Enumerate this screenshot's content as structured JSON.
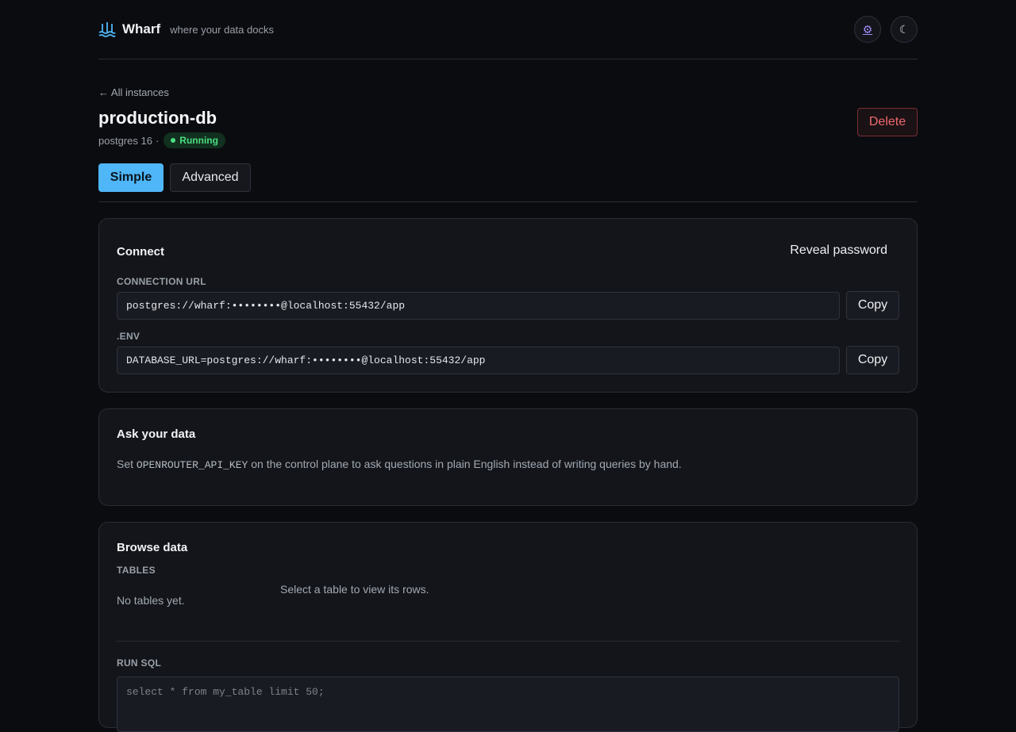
{
  "header": {
    "brand_name": "Wharf",
    "tagline": "where your data docks",
    "settings_icon": "⚙",
    "theme_icon": "☾"
  },
  "instance": {
    "back_link": "← All instances",
    "name": "production-db",
    "engine": "postgres 16",
    "separator": "·",
    "status": "Running",
    "delete_label": "Delete"
  },
  "tabs": [
    {
      "label": "Simple",
      "active": true
    },
    {
      "label": "Advanced",
      "active": false
    }
  ],
  "connect": {
    "title": "Connect",
    "reveal_label": "Reveal password",
    "url_label": "CONNECTION URL",
    "url_value": "postgres://wharf:••••••••@localhost:55432/app",
    "env_label": ".ENV",
    "env_value": "DATABASE_URL=postgres://wharf:••••••••@localhost:55432/app",
    "copy_label": "Copy"
  },
  "ask": {
    "title": "Ask your data",
    "text_before": "Set ",
    "code": "OPENROUTER_API_KEY",
    "text_after": " on the control plane to ask questions in plain English instead of writing queries by hand."
  },
  "browse": {
    "title": "Browse data",
    "tables_label": "TABLES",
    "empty_tables": "No tables yet.",
    "select_hint": "Select a table to view its rows.",
    "sql_label": "RUN SQL",
    "sql_placeholder": "select * from my_table limit 50;"
  },
  "colors": {
    "accent": "#4fb6f7",
    "danger": "#f0686f",
    "running": "#4ade80",
    "background": "#0b0c10"
  }
}
